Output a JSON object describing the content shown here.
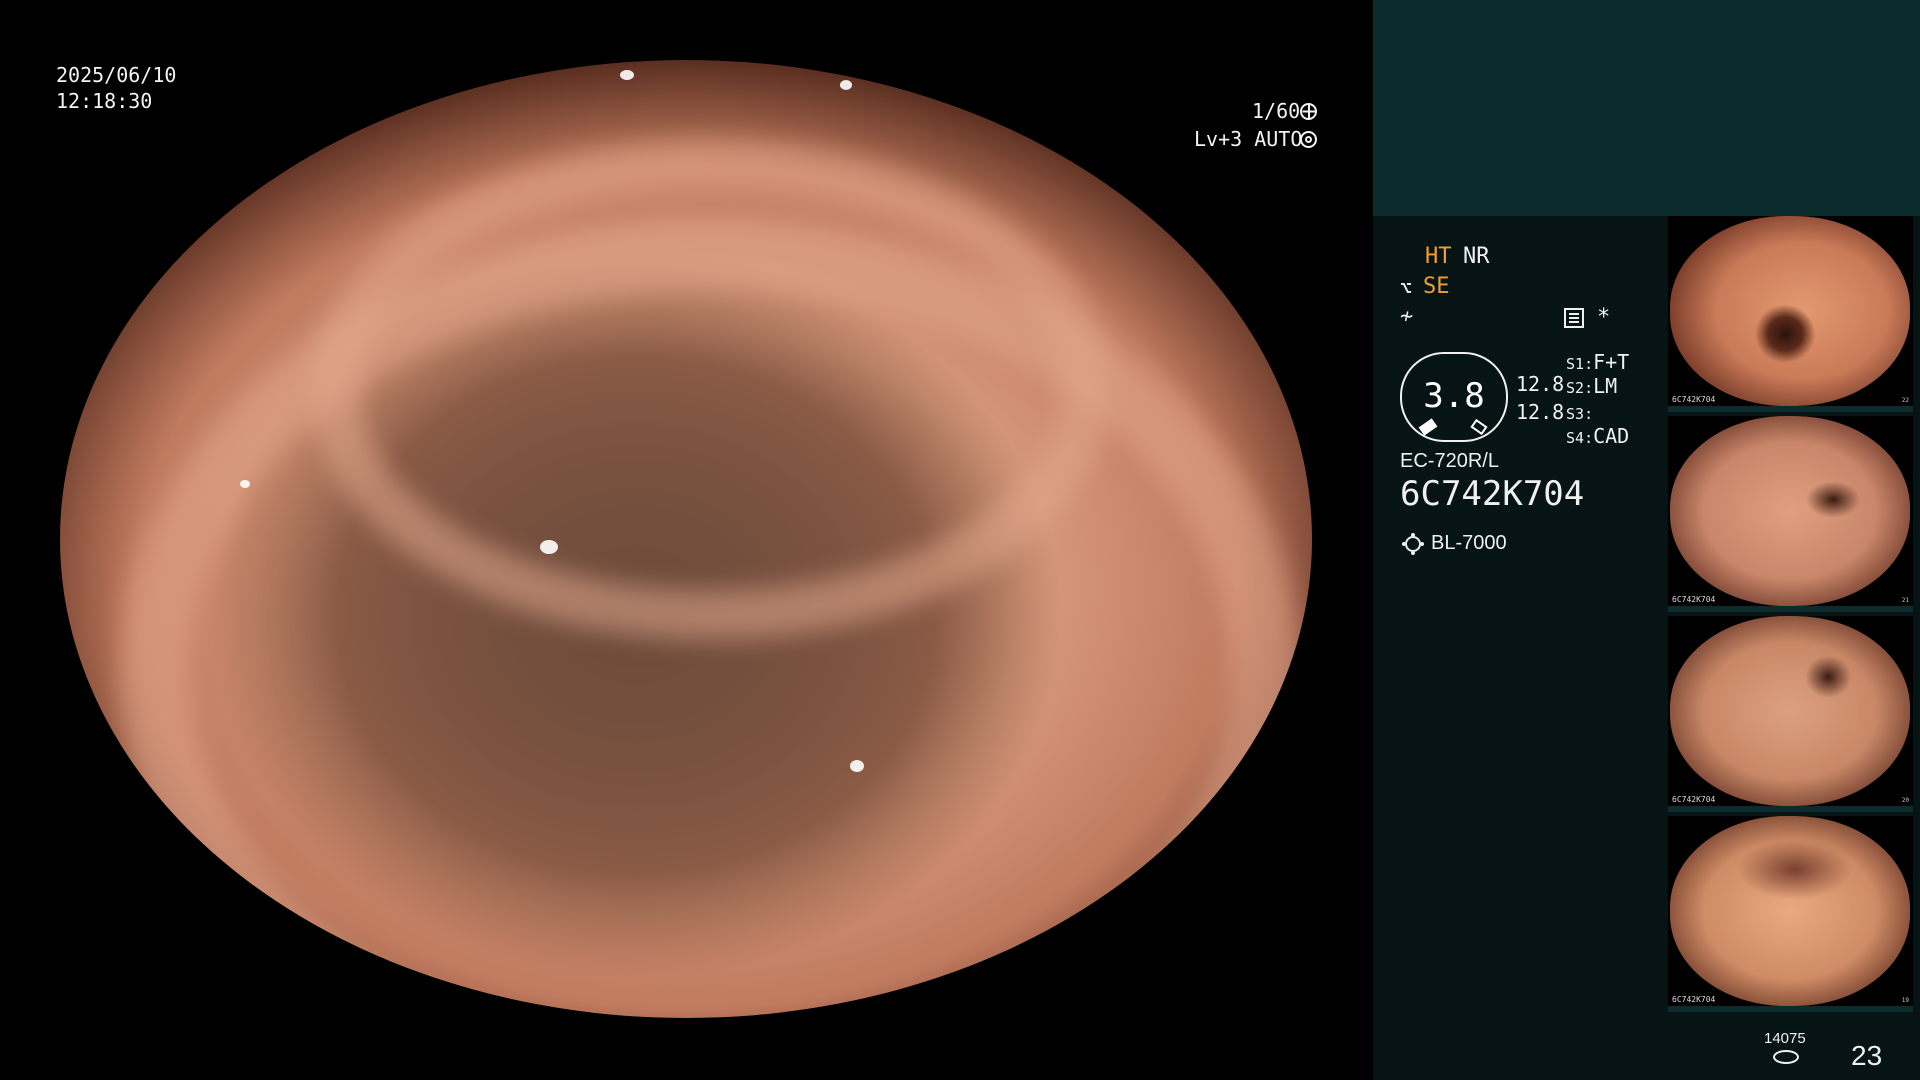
{
  "osd": {
    "date": "2025/06/10",
    "time": "12:18:30",
    "shutter": "1/60",
    "level": "Lv+3 AUTO",
    "shutter_icon": "shutter-icon",
    "auto_icon": "auto-exposure-icon"
  },
  "panel": {
    "ht": "HT",
    "nr": "NR",
    "se": "SE",
    "se_icon": "scope-enhance-icon",
    "f_icon": "freeze-icon",
    "menu_icon": "menu-list-icon",
    "star": "*",
    "gauge_value": "3.8",
    "gauge_num1": "12.8",
    "gauge_num2": "12.8",
    "s_lines": [
      {
        "label": "S1",
        "value": "F+T"
      },
      {
        "label": "S2",
        "value": "LM"
      },
      {
        "label": "S3",
        "value": ""
      },
      {
        "label": "S4",
        "value": "CAD"
      }
    ],
    "scope_model": "EC-720R/L",
    "scope_serial": "6C742K704",
    "light_model": "BL-7000",
    "counter": "14075",
    "frame_count": "23"
  },
  "thumbnails": [
    {
      "name": "capture-1",
      "label": "6C742K704",
      "side": "22"
    },
    {
      "name": "capture-2",
      "label": "6C742K704",
      "side": "21"
    },
    {
      "name": "capture-3",
      "label": "6C742K704",
      "side": "20"
    },
    {
      "name": "capture-4",
      "label": "6C742K704",
      "side": "19"
    }
  ],
  "colors": {
    "accent": "#f0a030",
    "panel_bg": "#071416",
    "panel_top": "#0b2b2c",
    "text": "#f0f0f0"
  }
}
